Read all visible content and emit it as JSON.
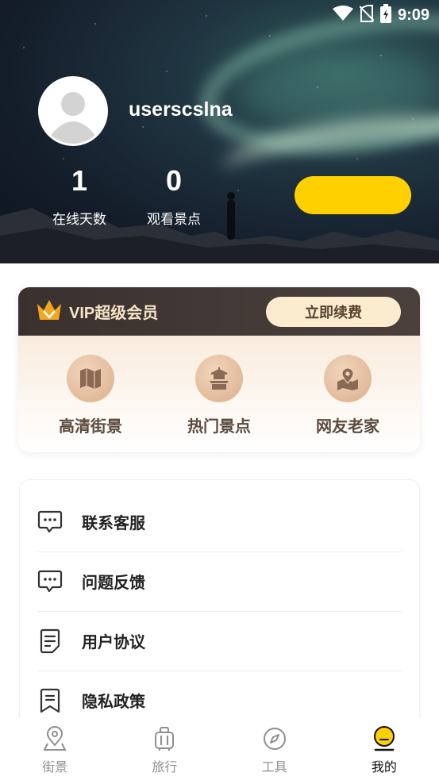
{
  "status_bar": {
    "time": "9:09",
    "icons": [
      "wifi-icon",
      "no-sim-icon",
      "battery-charging-icon"
    ]
  },
  "profile": {
    "username": "userscslna",
    "stats": [
      {
        "value": "1",
        "label": "在线天数"
      },
      {
        "value": "0",
        "label": "观看景点"
      }
    ],
    "action_button_label": ""
  },
  "vip": {
    "title": "VIP超级会员",
    "renew_label": "立即续费",
    "features": [
      {
        "label": "高清街景",
        "icon": "map-icon"
      },
      {
        "label": "热门景点",
        "icon": "temple-icon"
      },
      {
        "label": "网友老家",
        "icon": "location-map-icon"
      }
    ]
  },
  "menu": {
    "items": [
      {
        "label": "联系客服",
        "icon": "chat-bubble-icon"
      },
      {
        "label": "问题反馈",
        "icon": "chat-bubble-icon"
      },
      {
        "label": "用户协议",
        "icon": "document-icon"
      },
      {
        "label": "隐私政策",
        "icon": "bookmark-icon"
      }
    ]
  },
  "bottom_nav": {
    "items": [
      {
        "label": "街景",
        "icon": "location-pin-icon"
      },
      {
        "label": "旅行",
        "icon": "suitcase-icon"
      },
      {
        "label": "工具",
        "icon": "compass-icon"
      },
      {
        "label": "我的",
        "icon": "profile-face-icon",
        "active": true
      }
    ]
  },
  "colors": {
    "accent_yellow": "#ffd000",
    "vip_header": "#3a312f",
    "vip_gold": "#f6e5c8"
  }
}
